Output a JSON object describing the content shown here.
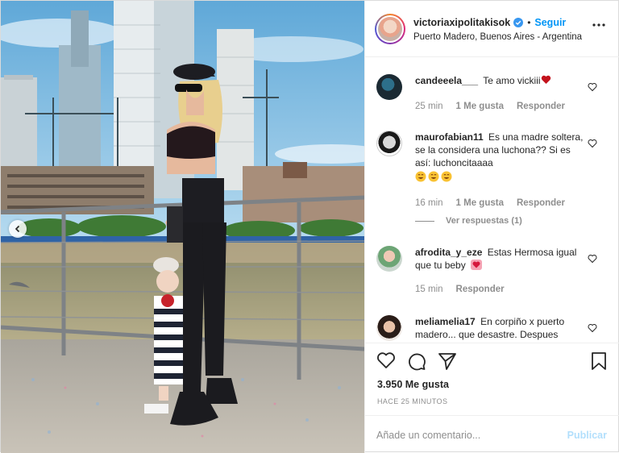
{
  "post": {
    "username": "victoriaxipolitakisok",
    "verified": true,
    "separator": "•",
    "follow_label": "Seguir",
    "location": "Puerto Madero, Buenos Aires - Argentina",
    "more_icon": "ellipsis-icon"
  },
  "comments": [
    {
      "user": "candeeela___",
      "text": "Te amo vickiii",
      "emoji": "heart",
      "time": "25 min",
      "likes": "1 Me gusta",
      "reply": "Responder"
    },
    {
      "user": "maurofabian11",
      "text": "Es una madre soltera, se la considera una luchona?? Si es así: luchoncitaaaa",
      "emoji": "smile x3",
      "time": "16 min",
      "likes": "1 Me gusta",
      "reply": "Responder",
      "view_replies": "Ver respuestas (1)"
    },
    {
      "user": "afrodita_y_eze",
      "text": "Estas Hermosa igual que tu beby",
      "emoji": "heart",
      "time": "15 min",
      "reply": "Responder"
    },
    {
      "user": "meliamelia17",
      "text": "En corpiño x puerto madero... que desastre. Despues"
    }
  ],
  "actions": {
    "like_icon": "heart-outline-icon",
    "comment_icon": "comment-icon",
    "share_icon": "paper-plane-icon",
    "save_icon": "bookmark-icon"
  },
  "likes_count": "3.950 Me gusta",
  "posted_ago": "HACE 25 MINUTOS",
  "comment_placeholder": "Añade un comentario...",
  "publish_label": "Publicar",
  "colors": {
    "link_blue": "#0095f6",
    "publish_disabled": "#b2dffc",
    "muted": "#8e8e8e",
    "heart_red": "#ed4956"
  }
}
